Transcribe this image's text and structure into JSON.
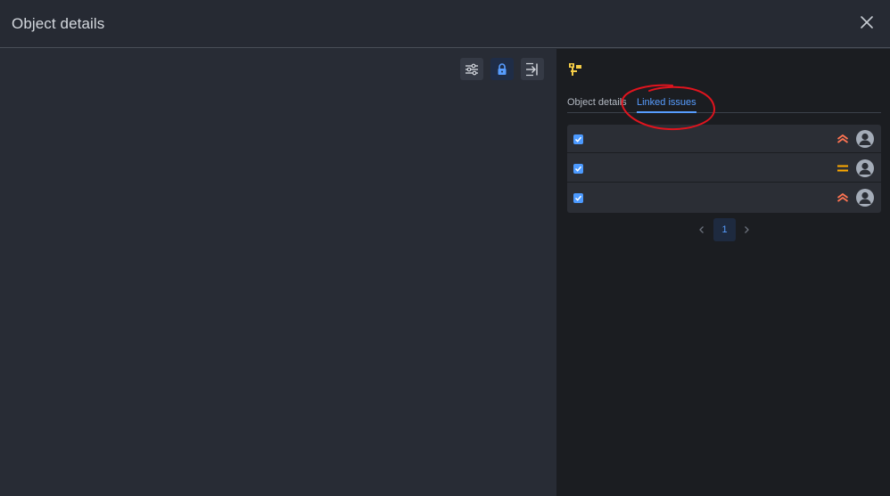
{
  "header": {
    "title": "Object details",
    "close_icon": "close-icon"
  },
  "toolbar": {
    "icons": [
      "sliders-icon",
      "lock-icon",
      "collapse-panel-icon"
    ]
  },
  "panel": {
    "object_icon": "object-type-icon",
    "tabs": [
      {
        "label": "Object details",
        "active": false
      },
      {
        "label": "Linked issues",
        "active": true
      }
    ],
    "issues": [
      {
        "checked": true,
        "priority": "high",
        "priority_icon": "priority-high-icon",
        "assignee_icon": "default-avatar-icon"
      },
      {
        "checked": true,
        "priority": "medium",
        "priority_icon": "priority-medium-icon",
        "assignee_icon": "default-avatar-icon"
      },
      {
        "checked": true,
        "priority": "high",
        "priority_icon": "priority-high-icon",
        "assignee_icon": "default-avatar-icon"
      }
    ],
    "pagination": {
      "current_page": "1"
    }
  },
  "colors": {
    "accent": "#579dff",
    "checkbox": "#4c9aff",
    "priority_high": "#ff7452",
    "priority_medium": "#ffab00",
    "annotation": "#e0141e"
  }
}
